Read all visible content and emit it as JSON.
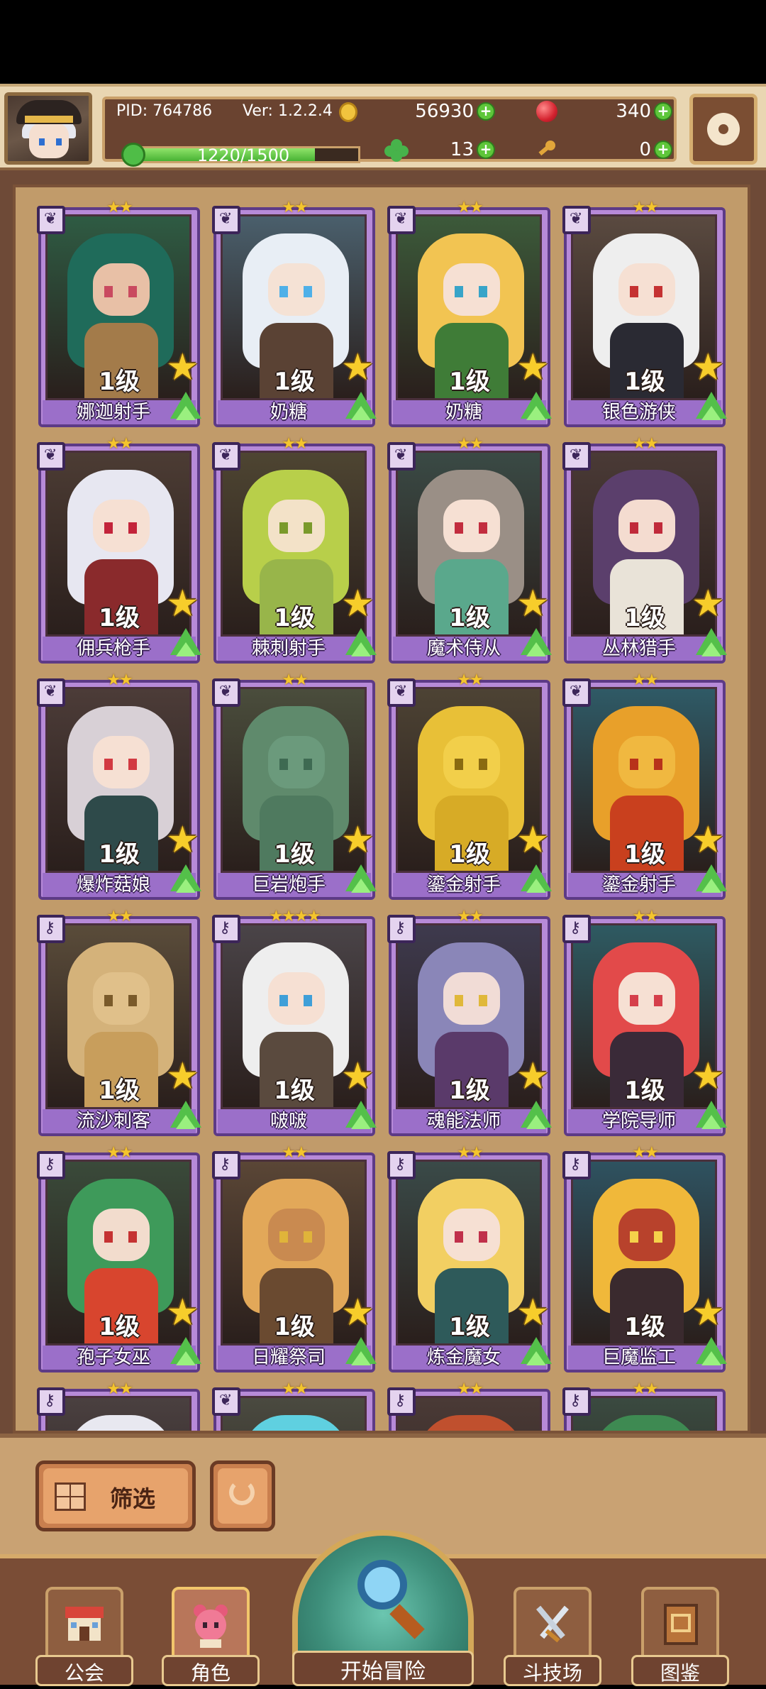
{
  "header": {
    "pid": "PID: 764786",
    "version": "Ver: 1.2.2.4",
    "coins": "56930",
    "gems": "340",
    "exp_text": "1220/1500",
    "exp_fraction": 0.813,
    "clovers": "13",
    "keys": "0",
    "icons": {
      "avatar": "player-avatar",
      "coin": "gold-coin-icon",
      "gem": "red-gem-icon",
      "clover": "clover-icon",
      "key": "key-icon",
      "settings": "gear-icon"
    }
  },
  "cards": [
    {
      "name": "娜迦射手",
      "level": "1级",
      "stars": "★★",
      "type": "leaf",
      "theme": [
        "#2e5b43",
        "#1f6b5a",
        "#e8c0a6",
        "#c94a5f",
        "#a37b4a"
      ]
    },
    {
      "name": "奶糖",
      "level": "1级",
      "stars": "★★",
      "type": "leaf",
      "theme": [
        "#4a5f6c",
        "#e8eef5",
        "#f5e2d5",
        "#4fb0e8",
        "#5a4234"
      ]
    },
    {
      "name": "奶糖",
      "level": "1级",
      "stars": "★★",
      "type": "leaf",
      "theme": [
        "#3c5a3a",
        "#f2c452",
        "#f6e0d3",
        "#38a4c8",
        "#3f7c37"
      ]
    },
    {
      "name": "银色游侠",
      "level": "1级",
      "stars": "★★",
      "type": "leaf",
      "theme": [
        "#5a4a40",
        "#eeeeee",
        "#f6e0d3",
        "#c53232",
        "#2a2a33"
      ]
    },
    {
      "name": "佣兵枪手",
      "level": "1级",
      "stars": "★★",
      "type": "leaf",
      "theme": [
        "#4c3c34",
        "#e7e7f1",
        "#f6e0d3",
        "#c3243a",
        "#8a2a2c"
      ]
    },
    {
      "name": "棘刺射手",
      "level": "1级",
      "stars": "★★",
      "type": "leaf",
      "theme": [
        "#4e4532",
        "#b8cf4a",
        "#f3e2c8",
        "#7a9a2b",
        "#98b54a"
      ]
    },
    {
      "name": "魔术侍从",
      "level": "1级",
      "stars": "★★",
      "type": "leaf",
      "theme": [
        "#3a4a45",
        "#9a8f86",
        "#f6e0d3",
        "#c22d3e",
        "#5aa88c"
      ]
    },
    {
      "name": "丛林猎手",
      "level": "1级",
      "stars": "★★",
      "type": "leaf",
      "theme": [
        "#4a3a36",
        "#5b3f6c",
        "#f4dcd0",
        "#c02a3a",
        "#e9e3d8"
      ]
    },
    {
      "name": "爆炸菇娘",
      "level": "1级",
      "stars": "★★",
      "type": "leaf",
      "theme": [
        "#4c3c38",
        "#d8d0d6",
        "#f6e0d3",
        "#d23a42",
        "#2e4a4a"
      ]
    },
    {
      "name": "巨岩炮手",
      "level": "1级",
      "stars": "★★",
      "type": "leaf",
      "theme": [
        "#4a4d3c",
        "#5f8a6c",
        "#6b9a7c",
        "#3e6a52",
        "#4f7a5f"
      ]
    },
    {
      "name": "鎏金射手",
      "level": "1级",
      "stars": "★★",
      "type": "leaf",
      "theme": [
        "#4d4334",
        "#e8c037",
        "#f2cf4a",
        "#8a6a10",
        "#d7ab26"
      ]
    },
    {
      "name": "鎏金射手",
      "level": "1级",
      "stars": "★★",
      "type": "leaf",
      "theme": [
        "#2f5a66",
        "#e8a02a",
        "#f0b840",
        "#b8321a",
        "#c9401e"
      ]
    },
    {
      "name": "流沙刺客",
      "level": "1级",
      "stars": "★★",
      "type": "key",
      "theme": [
        "#5a4c3a",
        "#d4b27a",
        "#e0c08a",
        "#7a5a2a",
        "#c89e5c"
      ]
    },
    {
      "name": "啵啵",
      "level": "1级",
      "stars": "★★★★",
      "type": "key",
      "theme": [
        "#4a4448",
        "#eeeeee",
        "#f6e0d3",
        "#3f9fd8",
        "#5a4a3e"
      ]
    },
    {
      "name": "魂能法师",
      "level": "1级",
      "stars": "★★",
      "type": "key",
      "theme": [
        "#3e3a4e",
        "#8a86b8",
        "#f1dcd6",
        "#e0b83a",
        "#5a3a6a"
      ]
    },
    {
      "name": "学院导师",
      "level": "1级",
      "stars": "★★",
      "type": "key",
      "theme": [
        "#2e5a62",
        "#e24a4a",
        "#f6e0d3",
        "#d53f4a",
        "#3a2a38"
      ]
    },
    {
      "name": "孢子女巫",
      "level": "1级",
      "stars": "★★",
      "type": "key",
      "theme": [
        "#3a4a3a",
        "#3e9a5a",
        "#f2dccd",
        "#c53232",
        "#d8452e"
      ]
    },
    {
      "name": "日耀祭司",
      "level": "1级",
      "stars": "★★",
      "type": "key",
      "theme": [
        "#5a4636",
        "#e2a859",
        "#c98a50",
        "#e0b43a",
        "#6a4a30"
      ]
    },
    {
      "name": "炼金魔女",
      "level": "1级",
      "stars": "★★",
      "type": "key",
      "theme": [
        "#3a4a48",
        "#f2cf62",
        "#f6e0d3",
        "#c0304a",
        "#2e5a5a"
      ]
    },
    {
      "name": "巨魔监工",
      "level": "1级",
      "stars": "★★",
      "type": "key",
      "theme": [
        "#2e5260",
        "#f0b83a",
        "#b8422c",
        "#f5d24a",
        "#3a2a2e"
      ]
    },
    {
      "name": "",
      "level": "",
      "stars": "★★",
      "type": "key",
      "theme": [
        "#4a4040",
        "#e8e8f0",
        "#f6e0d3",
        "#4a4a6a",
        "#888"
      ]
    },
    {
      "name": "",
      "level": "",
      "stars": "★★",
      "type": "leaf",
      "theme": [
        "#4a4a40",
        "#5fd0e0",
        "#a0ecf5",
        "#4a4a6a",
        "#888"
      ]
    },
    {
      "name": "",
      "level": "",
      "stars": "★★",
      "type": "key",
      "theme": [
        "#4a3a36",
        "#c0502e",
        "#e07a48",
        "#4a4a6a",
        "#888"
      ]
    },
    {
      "name": "",
      "level": "",
      "stars": "★★",
      "type": "key",
      "theme": [
        "#3a4a40",
        "#3e8a52",
        "#6ab070",
        "#4a4a6a",
        "#888"
      ]
    }
  ],
  "filter": {
    "filter_label": "筛选",
    "filter_icon": "grid-filter-icon",
    "refresh_icon": "refresh-icon"
  },
  "nav": {
    "guild": "公会",
    "character": "角色",
    "start": "开始冒险",
    "arena": "斗技场",
    "codex": "图鉴",
    "active": "character"
  }
}
